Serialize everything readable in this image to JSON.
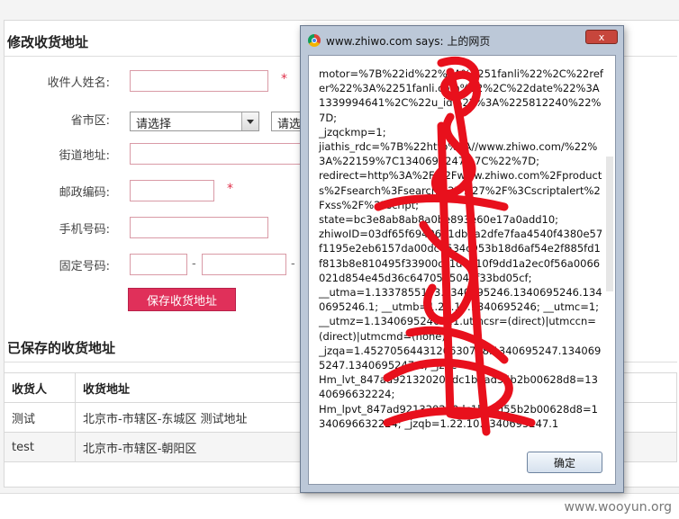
{
  "page": {
    "edit_title": "修改收货地址",
    "form": {
      "recipient_label": "收件人姓名:",
      "region_label": "省市区:",
      "region_select": "请选择",
      "region_select2": "请选",
      "street_label": "街道地址:",
      "postcode_label": "邮政编码:",
      "mobile_label": "手机号码:",
      "phone_label": "固定号码:",
      "required_mark": "*",
      "save_button": "保存收货地址"
    },
    "saved_title": "已保存的收货地址",
    "table": {
      "headers": [
        "收货人",
        "收货地址"
      ],
      "rows": [
        [
          "测试",
          "北京市-市辖区-东城区 测试地址"
        ],
        [
          "test",
          "北京市-市辖区-朝阳区"
        ]
      ]
    },
    "watermark": "www.wooyun.org"
  },
  "dialog": {
    "title": "www.zhiwo.com says: 上的网页",
    "message": "motor=%7B%22id%22%3A%2251fanli%22%2C%22refer%22%3A%2251fanli.com%22%2C%22date%22%3A1339994641%2C%22u_id%22%3A%225812240%22%7D;\n_jzqckmp=1;\njiathis_rdc=%7B%22http%3A//www.zhiwo.com/%22%3A%22159%7C1340695247%7C%22%7D;\nredirect=http%3A%2F%2Fwww.zhiwo.com%2Fproducts%2Fsearch%3Fsearch%3D%27%2F%3Cscriptalert%2Fxss%2F%2Fscript;\nstate=bc3e8ab8ab8a0be893e60e17a0add10;\nzhiwoID=03df65f69406d1db3a2dfe7faa4540f4380e57f1195e2eb6157da00dc6534c953b18d6af54e2f885fd1f813b8e810495f33900cc1d6d10f9dd1a2ec0f56a0066021d854e45d36c64705b5041f33bd05cf;\n__utma=1.1337855103.1340695246.1340695246.1340695246.1; __utmb=1.23.10.1340695246; __utmc=1;\n__utmz=1.1340695246.1.1.utmcsr=(direct)|utmccn=(direct)|utmcmd=(none);\n_jzqa=1.4527056443120630708.1340695247.1340695247.1340695247.1; _jzqc=1;\nHm_lvt_847ad921320200dc1bbad55b2b00628d8=1340696632224;\nHm_lpvt_847ad921320200dc1bbad55b2b00628d8=1340696632224; _jzqb=1.22.10.1340695247.1",
    "ok_button": "确定",
    "close_label": "x"
  }
}
